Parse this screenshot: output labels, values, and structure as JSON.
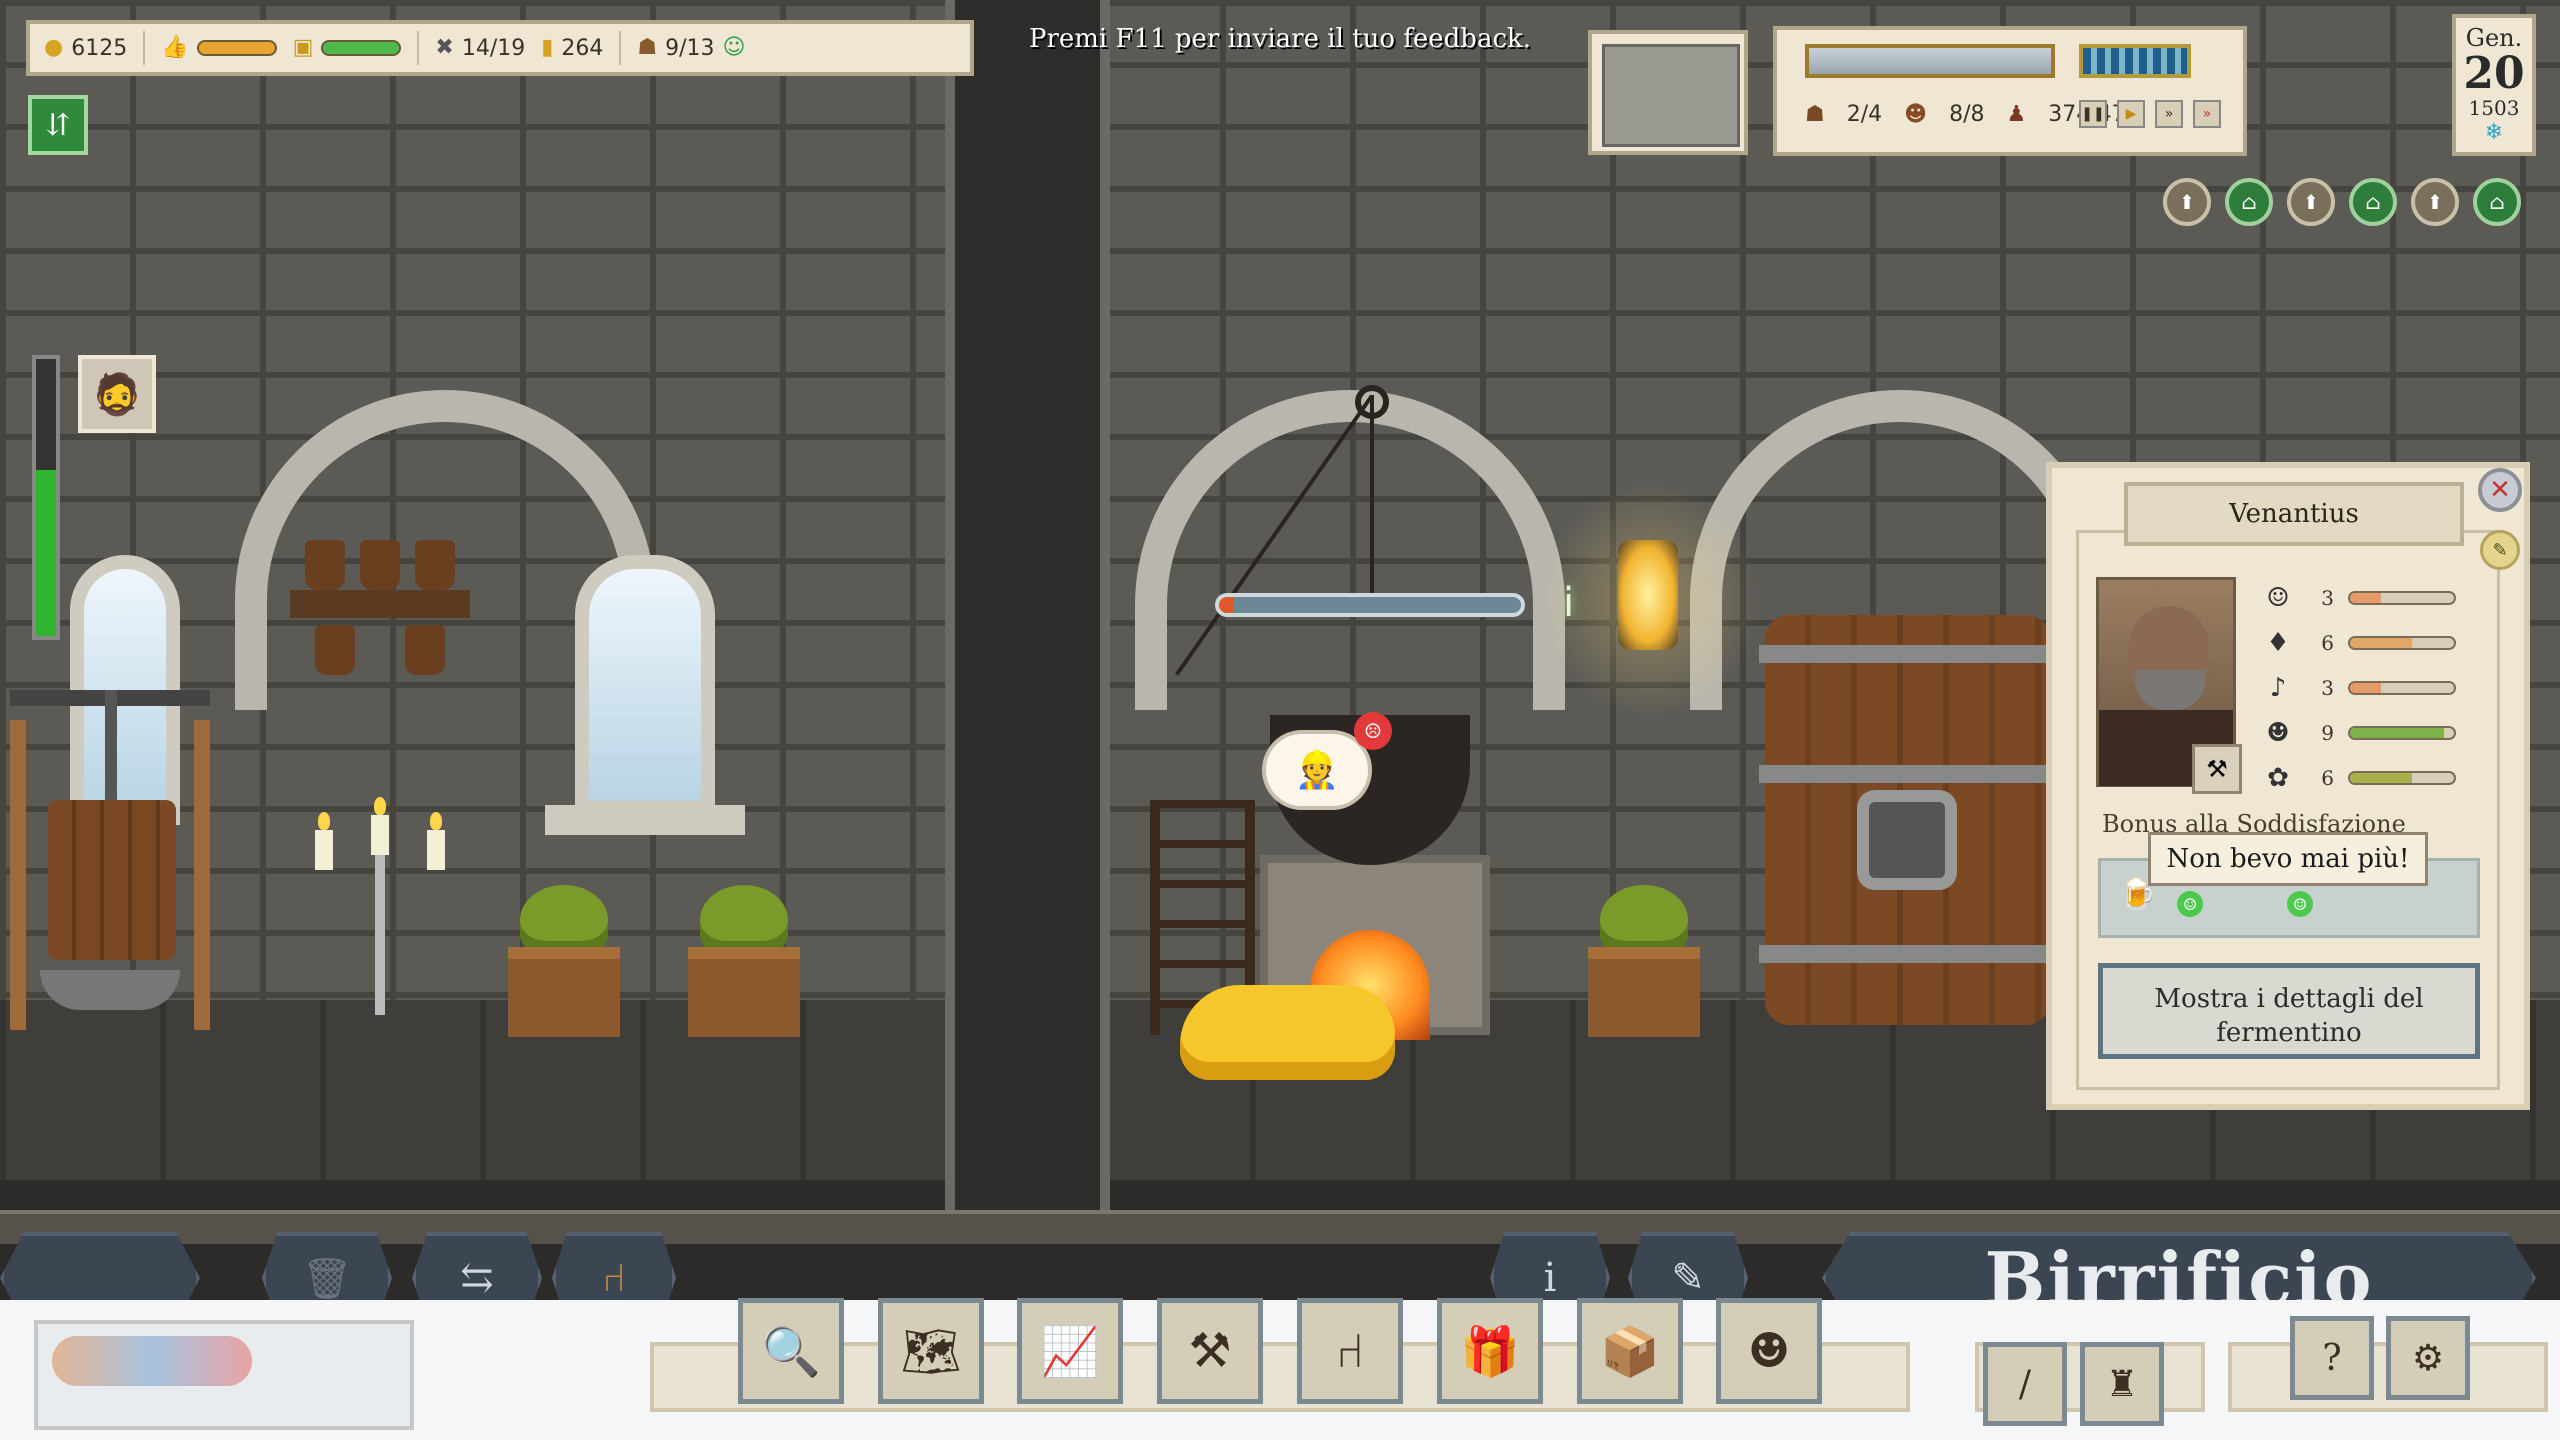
{
  "hud": {
    "coins": "6125",
    "workers": "14/19",
    "gold": "264",
    "customers": "9/13",
    "satisfaction_bar_color": "#e8a531",
    "storage_bar_color": "#4cb84c"
  },
  "feedback_hint": "Premi F11 per inviare il tuo feedback.",
  "time_panel": {
    "rooms": "2/4",
    "staff": "8/8",
    "stock": "374/475"
  },
  "date": {
    "month": "Gen.",
    "day": "20",
    "year": "1503"
  },
  "status_bar_level": 0.6,
  "craft_progress": 0.05,
  "character": {
    "name": "Venantius",
    "stats": [
      {
        "icon": "mask-icon",
        "value": "3",
        "color": "#e89a6a",
        "level": 0.3
      },
      {
        "icon": "bulb-icon",
        "value": "6",
        "color": "#e0a868",
        "level": 0.6
      },
      {
        "icon": "music-icon",
        "value": "3",
        "color": "#e89a6a",
        "level": 0.3
      },
      {
        "icon": "smile-icon",
        "value": "9",
        "color": "#7fb04a",
        "level": 0.9
      },
      {
        "icon": "brain-icon",
        "value": "6",
        "color": "#a8b04a",
        "level": 0.6
      }
    ],
    "bonus_label": "Bonus alla Soddisfazione",
    "tooltip": "Non bevo mai più!",
    "ferment_button": "Mostra i dettagli del fermentino"
  },
  "room_title": "Birrificio",
  "toolbar": {
    "items": [
      "magnifier-icon",
      "map-icon",
      "chart-icon",
      "tools-icon",
      "chair-icon",
      "gift-icon",
      "box-icon",
      "monk-icon"
    ]
  },
  "icons": {
    "coin": "●",
    "thumb": "👍",
    "tools": "✖",
    "gold": "▮",
    "face": "☺"
  }
}
